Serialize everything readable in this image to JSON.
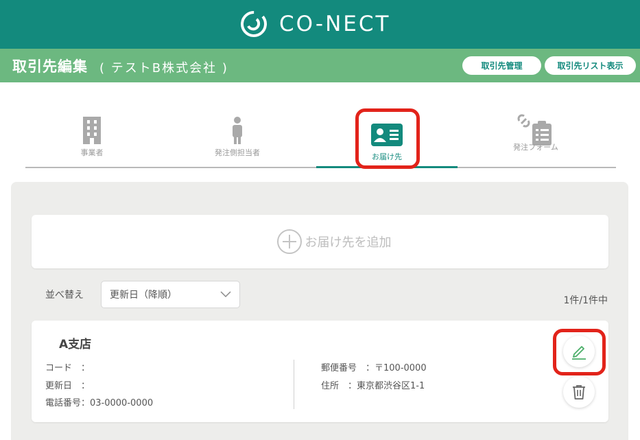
{
  "header": {
    "logo_text": "CO-NECT",
    "logo_icon": "conect-logo-icon",
    "brand_color": "#138a7d",
    "title": "取引先編集",
    "subtitle": "( テストB株式会社 )",
    "buttons": [
      {
        "label": "取引先管理"
      },
      {
        "label": "取引先リスト表示"
      }
    ]
  },
  "tabs": [
    {
      "label": "事業者",
      "icon": "building-icon",
      "active": false
    },
    {
      "label": "発注側担当者",
      "icon": "person-icon",
      "active": false
    },
    {
      "label": "お届け先",
      "icon": "contact-card-icon",
      "active": true
    },
    {
      "label": "発注フォーム",
      "icon": "clipboard-link-icon",
      "active": false
    }
  ],
  "add_delivery": {
    "label": "お届け先を追加",
    "icon": "plus-circle-icon"
  },
  "sort": {
    "label": "並べ替え",
    "selected": "更新日（降順）",
    "icon": "chevron-down-icon"
  },
  "count": "1件/1件中",
  "delivery_card": {
    "name": "A支店",
    "left": [
      {
        "label": "コード　：",
        "value": ""
      },
      {
        "label": "更新日　：",
        "value": ""
      },
      {
        "label": "電話番号：",
        "value": "03-0000-0000"
      }
    ],
    "right": [
      {
        "label": "郵便番号　：",
        "value": "〒100-0000"
      },
      {
        "label": "住所　：",
        "value": "東京都渋谷区1-1"
      }
    ],
    "actions": [
      {
        "name": "edit",
        "icon": "pencil-icon"
      },
      {
        "name": "delete",
        "icon": "trash-icon"
      }
    ]
  },
  "highlight_color": "#e2231a"
}
